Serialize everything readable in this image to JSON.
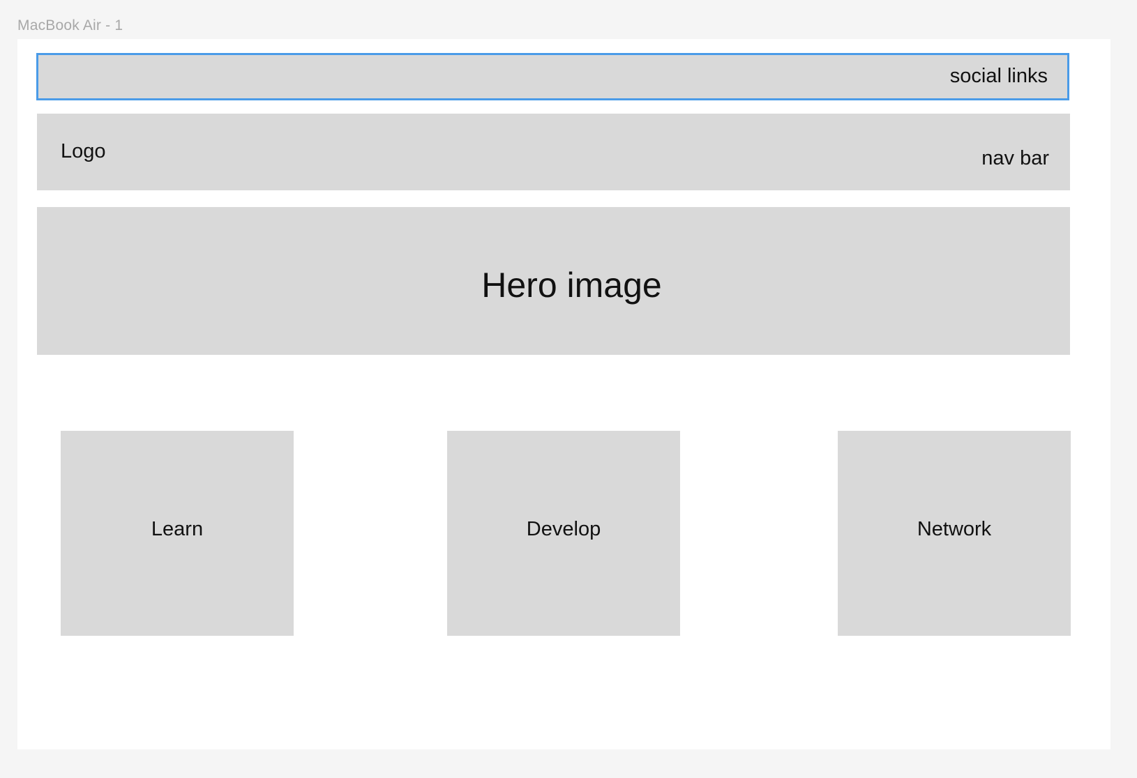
{
  "frame": {
    "label": "MacBook Air - 1"
  },
  "header": {
    "social_links_label": "social links"
  },
  "navbar": {
    "logo_label": "Logo",
    "nav_label": "nav bar"
  },
  "hero": {
    "label": "Hero image"
  },
  "cards": [
    {
      "label": "Learn"
    },
    {
      "label": "Develop"
    },
    {
      "label": "Network"
    }
  ],
  "colors": {
    "canvas_background": "#f5f5f5",
    "frame_background": "#ffffff",
    "placeholder_fill": "#d9d9d9",
    "selection_outline": "#4a9be8",
    "frame_label_text": "#a8a8a8"
  }
}
